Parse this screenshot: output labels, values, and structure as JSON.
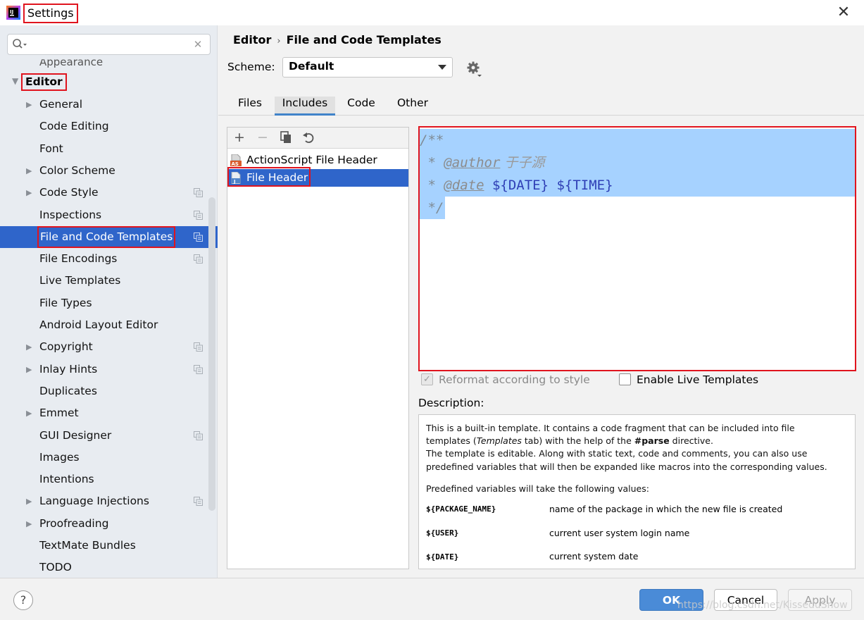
{
  "window": {
    "title": "Settings",
    "close_glyph": "✕"
  },
  "sidebar": {
    "search": {
      "placeholder": "",
      "clear_glyph": "✕"
    },
    "cut_item": "Appearance",
    "editor_label": "Editor",
    "items": [
      {
        "label": "General",
        "expandable": true,
        "copy_icon": false
      },
      {
        "label": "Code Editing",
        "expandable": false,
        "copy_icon": false
      },
      {
        "label": "Font",
        "expandable": false,
        "copy_icon": false
      },
      {
        "label": "Color Scheme",
        "expandable": true,
        "copy_icon": false
      },
      {
        "label": "Code Style",
        "expandable": true,
        "copy_icon": true
      },
      {
        "label": "Inspections",
        "expandable": false,
        "copy_icon": true
      },
      {
        "label": "File and Code Templates",
        "expandable": false,
        "copy_icon": true,
        "selected": true
      },
      {
        "label": "File Encodings",
        "expandable": false,
        "copy_icon": true
      },
      {
        "label": "Live Templates",
        "expandable": false,
        "copy_icon": false
      },
      {
        "label": "File Types",
        "expandable": false,
        "copy_icon": false
      },
      {
        "label": "Android Layout Editor",
        "expandable": false,
        "copy_icon": false
      },
      {
        "label": "Copyright",
        "expandable": true,
        "copy_icon": true
      },
      {
        "label": "Inlay Hints",
        "expandable": true,
        "copy_icon": true
      },
      {
        "label": "Duplicates",
        "expandable": false,
        "copy_icon": false
      },
      {
        "label": "Emmet",
        "expandable": true,
        "copy_icon": false
      },
      {
        "label": "GUI Designer",
        "expandable": false,
        "copy_icon": true
      },
      {
        "label": "Images",
        "expandable": false,
        "copy_icon": false
      },
      {
        "label": "Intentions",
        "expandable": false,
        "copy_icon": false
      },
      {
        "label": "Language Injections",
        "expandable": true,
        "copy_icon": true
      },
      {
        "label": "Proofreading",
        "expandable": true,
        "copy_icon": false
      },
      {
        "label": "TextMate Bundles",
        "expandable": false,
        "copy_icon": false
      },
      {
        "label": "TODO",
        "expandable": false,
        "copy_icon": false
      }
    ]
  },
  "breadcrumb": {
    "root": "Editor",
    "separator": "›",
    "current": "File and Code Templates"
  },
  "scheme": {
    "label": "Scheme:",
    "value": "Default"
  },
  "tabs": [
    {
      "label": "Files"
    },
    {
      "label": "Includes",
      "active": true
    },
    {
      "label": "Code"
    },
    {
      "label": "Other"
    }
  ],
  "toolbar": {
    "add": "+",
    "remove": "−",
    "copy": "⧉",
    "reset": "↶"
  },
  "templates": [
    {
      "label": "ActionScript File Header",
      "icon": "actionscript-file-icon"
    },
    {
      "label": "File Header",
      "icon": "java-file-icon",
      "selected": true
    }
  ],
  "code": {
    "line1": "/**",
    "line2_prefix": " * ",
    "line2_tag": "@author",
    "line2_text": " 于子源",
    "line3_prefix": " * ",
    "line3_tag": "@date",
    "line3_text": " ${DATE} ${TIME}",
    "line4": " */"
  },
  "options": {
    "reformat_label": "Reformat according to style",
    "reformat_checked": true,
    "live_label": "Enable Live Templates",
    "live_checked": false
  },
  "description": {
    "label": "Description:",
    "line1": "This is a built-in template. It contains a code fragment that can be included into file",
    "line2a": "templates (",
    "line2b": "Templates",
    "line2c": " tab) with the help of the ",
    "line2d": "#parse",
    "line2e": " directive.",
    "line3": "The template is editable. Along with static text, code and comments, you can also use",
    "line4": "predefined variables that will then be expanded like macros into the corresponding values.",
    "line5": "Predefined variables will take the following values:",
    "variables": [
      {
        "name": "${PACKAGE_NAME}",
        "desc": "name of the package in which the new file is created"
      },
      {
        "name": "${USER}",
        "desc": "current user system login name"
      },
      {
        "name": "${DATE}",
        "desc": "current system date"
      }
    ]
  },
  "buttons": {
    "help": "?",
    "ok": "OK",
    "cancel": "Cancel",
    "apply": "Apply"
  },
  "watermark": "https://blog.csdn.net/KisseduSnow",
  "colors": {
    "accent": "#2f65ca",
    "highlight": "#e0141e",
    "selection": "#a6d2ff"
  }
}
